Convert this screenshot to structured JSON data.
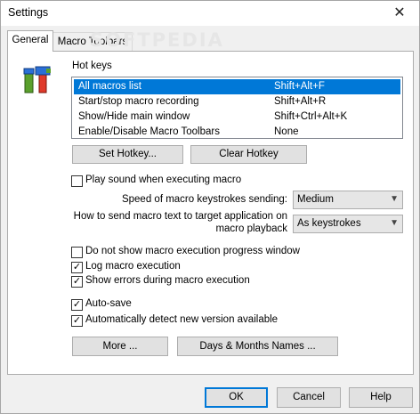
{
  "window": {
    "title": "Settings",
    "close": "✕"
  },
  "watermark": "SOFTPEDIA",
  "tabs": [
    {
      "label": "General",
      "active": true
    },
    {
      "label": "Macro Toolbars",
      "active": false
    }
  ],
  "hotkeys": {
    "label": "Hot keys",
    "rows": [
      {
        "action": "All macros list",
        "key": "Shift+Alt+F",
        "selected": true
      },
      {
        "action": "Start/stop macro recording",
        "key": "Shift+Alt+R",
        "selected": false
      },
      {
        "action": "Show/Hide main window",
        "key": "Shift+Ctrl+Alt+K",
        "selected": false
      },
      {
        "action": "Enable/Disable Macro Toolbars",
        "key": "None",
        "selected": false
      }
    ],
    "set_label": "Set Hotkey...",
    "clear_label": "Clear Hotkey"
  },
  "options": {
    "play_sound": {
      "label": "Play sound when executing macro",
      "checked": false
    },
    "speed_label": "Speed of macro keystrokes sending:",
    "speed_value": "Medium",
    "send_label_1": "How to send macro text to target application on",
    "send_label_2": "macro playback",
    "send_value": "As keystrokes",
    "no_progress": {
      "label": "Do not show macro execution progress window",
      "checked": false
    },
    "log_exec": {
      "label": "Log macro execution",
      "checked": true
    },
    "show_errors": {
      "label": "Show errors during macro execution",
      "checked": true
    },
    "auto_save": {
      "label": "Auto-save",
      "checked": true
    },
    "auto_detect": {
      "label": "Automatically detect new version available",
      "checked": true
    }
  },
  "buttons": {
    "more": "More ...",
    "days_months": "Days & Months Names ...",
    "ok": "OK",
    "cancel": "Cancel",
    "help": "Help"
  },
  "colors": {
    "selection": "#0078d7",
    "logo_red": "#e03a2a",
    "logo_green": "#5aa02c",
    "logo_blue": "#2a6fd6"
  }
}
